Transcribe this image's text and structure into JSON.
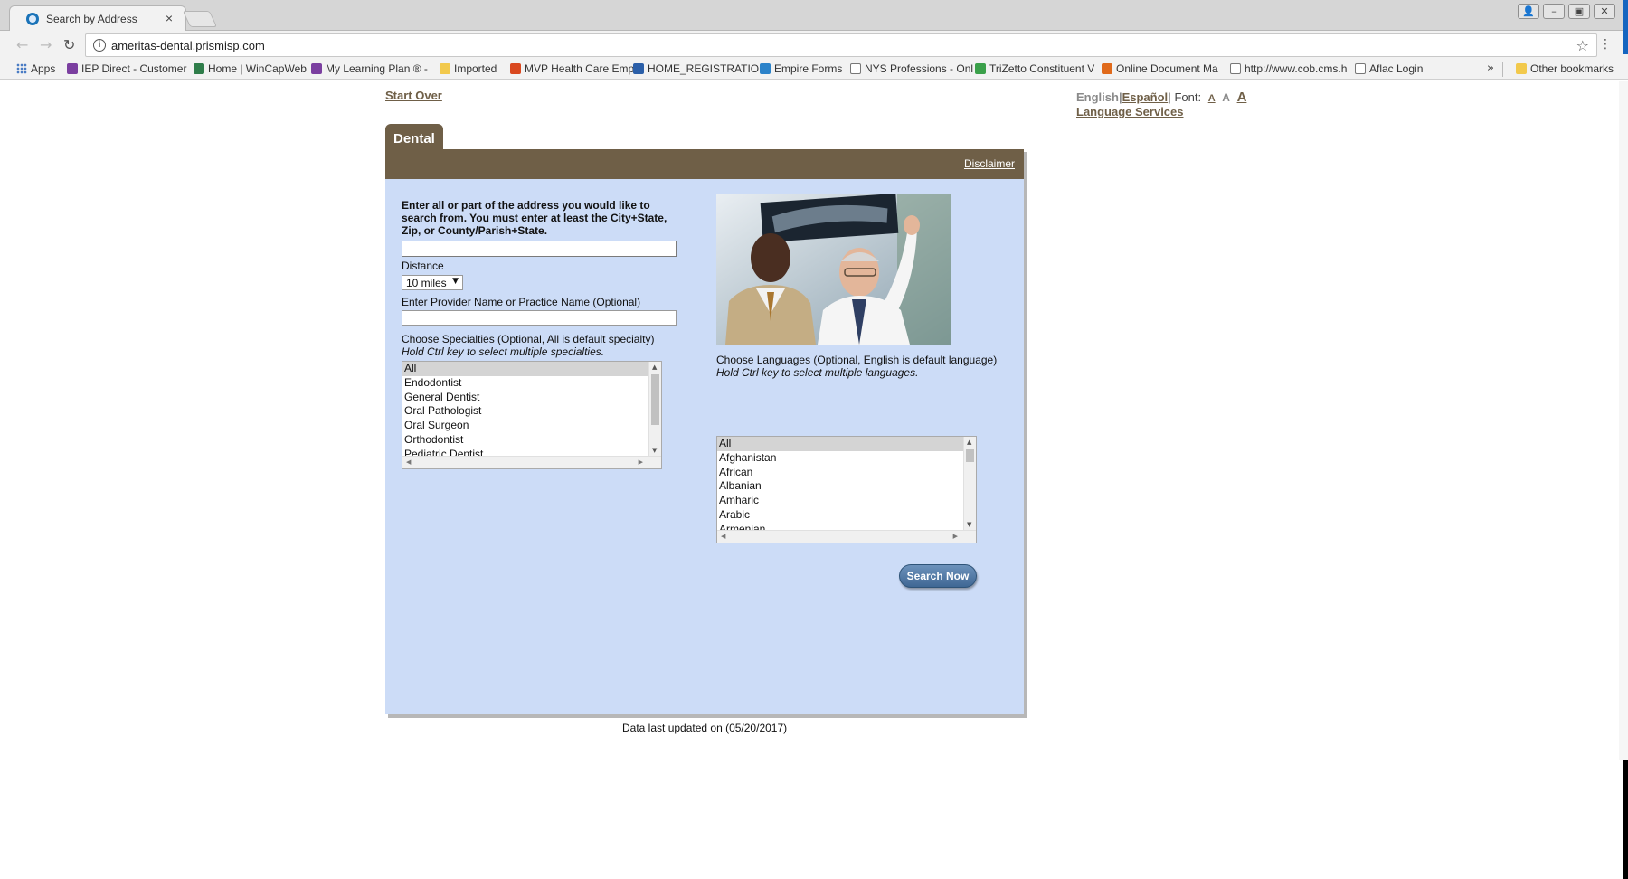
{
  "browser": {
    "tab_title": "Search by Address",
    "tab_close": "×",
    "url": "ameritas-dental.prismisp.com",
    "bookmarks": [
      {
        "label": "Apps",
        "icon": "apps-grid-icon",
        "color": "#4a7cc4"
      },
      {
        "label": "IEP Direct - Customer",
        "icon": "iep-icon",
        "color": "#7b3fa0"
      },
      {
        "label": "Home | WinCapWeb",
        "icon": "wincap-icon",
        "color": "#2f7d4a"
      },
      {
        "label": "My Learning Plan ® -",
        "icon": "learning-plan-icon",
        "color": "#7b3fa0"
      },
      {
        "label": "Imported",
        "icon": "folder-icon",
        "color": "#f2c94c"
      },
      {
        "label": "MVP Health Care Emp",
        "icon": "mvp-icon",
        "color": "#d9481f"
      },
      {
        "label": "HOME_REGISTRATIO",
        "icon": "registration-icon",
        "color": "#2b5fa8"
      },
      {
        "label": "Empire Forms",
        "icon": "empire-icon",
        "color": "#2b82c9"
      },
      {
        "label": "NYS Professions - Onl",
        "icon": "page-icon",
        "color": "#ffffff"
      },
      {
        "label": "TriZetto Constituent V",
        "icon": "trizetto-icon",
        "color": "#3aa04a"
      },
      {
        "label": "Online Document Ma",
        "icon": "online-doc-icon",
        "color": "#e06a1b"
      },
      {
        "label": "http://www.cob.cms.h",
        "icon": "page-icon",
        "color": "#ffffff"
      },
      {
        "label": "Aflac Login",
        "icon": "page-icon",
        "color": "#ffffff"
      }
    ],
    "overflow": "»",
    "other_bookmarks": "Other bookmarks"
  },
  "page": {
    "start_over": "Start Over",
    "lang_english": "English",
    "lang_spanish": "Español",
    "font_label": "Font:",
    "font_small": "A",
    "font_medium": "A",
    "font_large": "A",
    "language_services": "Language Services",
    "tab_label": "Dental",
    "disclaimer": "Disclaimer",
    "instructions": "Enter all or part of the address you would like to search from. You must enter at least the City+State, Zip, or County/Parish+State.",
    "address_value": "",
    "distance_label": "Distance",
    "distance_value": "10 miles",
    "provider_label": "Enter Provider Name or Practice Name (Optional)",
    "provider_value": "",
    "specialties_label": "Choose Specialties (Optional, All is default specialty)",
    "specialties_hint": "Hold Ctrl key to select multiple specialties.",
    "specialties": [
      "All",
      "Endodontist",
      "General Dentist",
      "Oral Pathologist",
      "Oral Surgeon",
      "Orthodontist",
      "Pediatric Dentist"
    ],
    "languages_label": "Choose Languages (Optional, English is default language)",
    "languages_hint": "Hold Ctrl key to select multiple languages.",
    "languages": [
      "All",
      "Afghanistan",
      "African",
      "Albanian",
      "Amharic",
      "Arabic",
      "Armenian"
    ],
    "search_button": "Search Now",
    "last_updated": "Data last updated on (05/20/2017)"
  },
  "colors": {
    "brand_brown": "#6f5f47",
    "panel_blue": "#ccdcf7",
    "button_blue": "#4a74a2"
  }
}
